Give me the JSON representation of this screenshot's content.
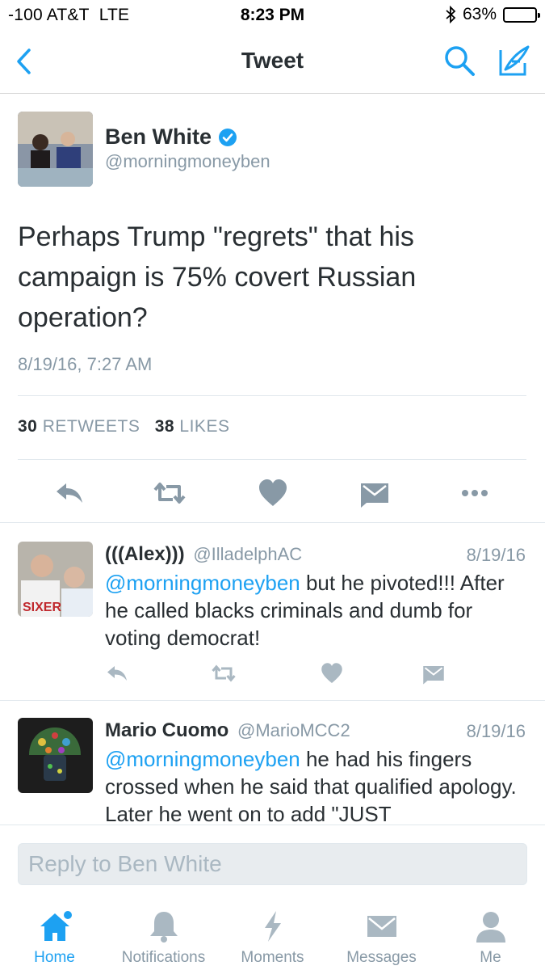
{
  "status_bar": {
    "carrier": "-100 AT&T",
    "network": "LTE",
    "time": "8:23 PM",
    "battery_text": "63%",
    "battery_level": 0.63
  },
  "nav": {
    "title": "Tweet"
  },
  "tweet": {
    "author_name": "Ben White",
    "author_handle": "@morningmoneyben",
    "text": "Perhaps Trump \"regrets\" that his campaign is 75% covert Russian operation?",
    "timestamp": "8/19/16, 7:27 AM",
    "retweet_count": "30",
    "retweet_label": "RETWEETS",
    "like_count": "38",
    "like_label": "LIKES"
  },
  "replies": [
    {
      "name": "(((Alex)))",
      "handle": "@IlladelphAC",
      "date": "8/19/16",
      "mention": "@morningmoneyben",
      "text": " but he pivoted!!! After he called blacks criminals and dumb for voting democrat!"
    },
    {
      "name": "Mario Cuomo",
      "handle": "@MarioMCC2",
      "date": "8/19/16",
      "mention": "@morningmoneyben",
      "text": " he had his fingers crossed when he said that qualified apology. Later he went on to add \"JUST"
    }
  ],
  "reply_box": {
    "placeholder": "Reply to Ben White"
  },
  "tabs": [
    {
      "label": "Home",
      "icon": "home-icon",
      "active": true
    },
    {
      "label": "Notifications",
      "icon": "bell-icon",
      "active": false
    },
    {
      "label": "Moments",
      "icon": "lightning-icon",
      "active": false
    },
    {
      "label": "Messages",
      "icon": "envelope-icon",
      "active": false
    },
    {
      "label": "Me",
      "icon": "person-icon",
      "active": false
    }
  ],
  "colors": {
    "accent": "#1da1f2",
    "muted": "#8899a6",
    "text": "#292f33",
    "icon_gray": "#aab8c2"
  }
}
